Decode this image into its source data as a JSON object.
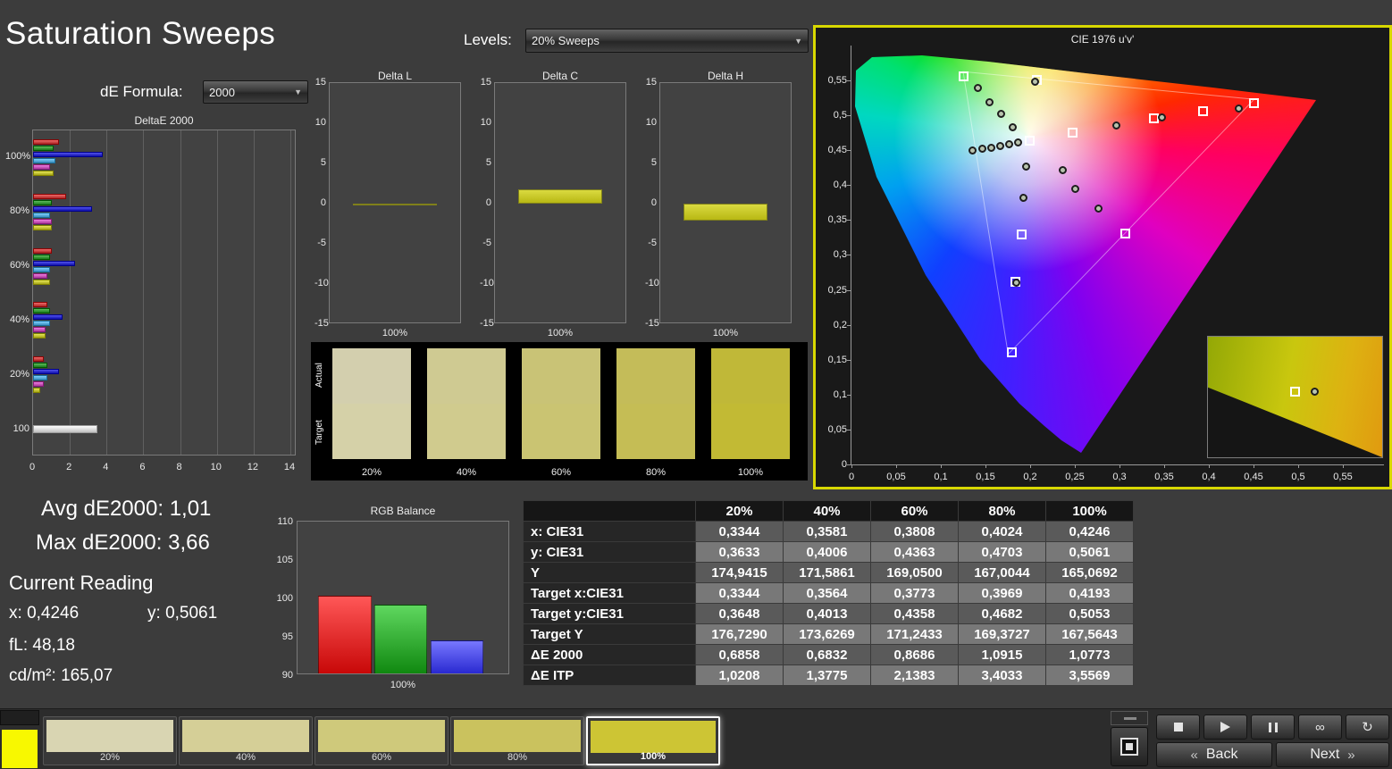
{
  "header": {
    "title": "Saturation Sweeps",
    "levels_label": "Levels:",
    "levels_value": "20% Sweeps",
    "de_formula_label": "dE Formula:",
    "de_formula_value": "2000",
    "dropdown_arrow": "▼"
  },
  "stats": {
    "avg_label": "Avg dE2000:",
    "avg_value": "1,01",
    "max_label": "Max dE2000:",
    "max_value": "3,66"
  },
  "current_reading": {
    "title": "Current Reading",
    "x_label": "x:",
    "x_value": "0,4246",
    "y_label": "y:",
    "y_value": "0,5061",
    "fl_label": "fL:",
    "fl_value": "48,18",
    "cd_label": "cd/m²:",
    "cd_value": "165,07"
  },
  "chart_data": [
    {
      "id": "deltae_2000",
      "type": "bar",
      "orientation": "horizontal",
      "title": "DeltaE 2000",
      "xlim": [
        0,
        14
      ],
      "x_ticks": [
        "0",
        "2",
        "4",
        "6",
        "8",
        "10",
        "12",
        "14"
      ],
      "series_names": [
        "red",
        "green",
        "blue",
        "cyan",
        "magenta",
        "yellow"
      ],
      "series_colors": [
        "#d14a4a",
        "#3f9e3f",
        "#3434cf",
        "#5fb3e0",
        "#cf5fc0",
        "#c9c93a"
      ],
      "grayscale_color": "#e2e2e2",
      "groups": [
        {
          "label": "100%",
          "values": [
            1.4,
            1.1,
            3.8,
            1.2,
            0.9,
            1.1
          ]
        },
        {
          "label": "80%",
          "values": [
            1.8,
            1.0,
            3.2,
            0.9,
            1.0,
            1.0
          ]
        },
        {
          "label": "60%",
          "values": [
            1.0,
            0.9,
            2.3,
            0.9,
            0.8,
            0.9
          ]
        },
        {
          "label": "40%",
          "values": [
            0.8,
            0.9,
            1.6,
            0.9,
            0.7,
            0.7
          ]
        },
        {
          "label": "20%",
          "values": [
            0.6,
            0.8,
            1.4,
            0.8,
            0.6,
            0.4
          ]
        },
        {
          "label": "100",
          "values": [
            3.5
          ],
          "single": true
        }
      ]
    },
    {
      "id": "delta_l",
      "type": "bar",
      "title": "Delta L",
      "ylim": [
        -15,
        15
      ],
      "y_ticks": [
        "15",
        "10",
        "5",
        "0",
        "-5",
        "-10",
        "-15"
      ],
      "xlabel": "100%",
      "categories": [
        "100%"
      ],
      "values": [
        -0.2
      ],
      "bar_color": "#c9c92a"
    },
    {
      "id": "delta_c",
      "type": "bar",
      "title": "Delta C",
      "ylim": [
        -15,
        15
      ],
      "y_ticks": [
        "15",
        "10",
        "5",
        "0",
        "-5",
        "-10",
        "-15"
      ],
      "xlabel": "100%",
      "categories": [
        "100%"
      ],
      "values": [
        1.8
      ],
      "bar_color": "#c9c92a"
    },
    {
      "id": "delta_h",
      "type": "bar",
      "title": "Delta H",
      "ylim": [
        -15,
        15
      ],
      "y_ticks": [
        "15",
        "10",
        "5",
        "0",
        "-5",
        "-10",
        "-15"
      ],
      "xlabel": "100%",
      "categories": [
        "100%"
      ],
      "values": [
        -2.1
      ],
      "bar_color": "#c9c92a"
    },
    {
      "id": "rgb_balance",
      "type": "bar",
      "title": "RGB Balance",
      "ylim": [
        90,
        110
      ],
      "y_ticks": [
        "110",
        "105",
        "100",
        "95",
        "90"
      ],
      "xlabel": "100%",
      "categories": [
        "Red",
        "Green",
        "Blue"
      ],
      "values": [
        100.4,
        99.2,
        94.5
      ],
      "colors": [
        "#e02020",
        "#28a028",
        "#4040e8"
      ]
    },
    {
      "id": "cie_1976",
      "type": "scatter",
      "title": "CIE 1976 u'v'",
      "xlim": [
        0,
        0.6
      ],
      "ylim": [
        0,
        0.6
      ],
      "u_ticks": [
        "0",
        "0,05",
        "0,1",
        "0,15",
        "0,2",
        "0,25",
        "0,3",
        "0,35",
        "0,4",
        "0,45",
        "0,5",
        "0,55"
      ],
      "v_ticks": [
        "0",
        "0,05",
        "0,1",
        "0,15",
        "0,2",
        "0,25",
        "0,3",
        "0,35",
        "0,4",
        "0,45",
        "0,5",
        "0,55"
      ],
      "white_point": {
        "u": 0.198,
        "v": 0.468
      },
      "gamut_triangle": [
        [
          0.125,
          0.5625
        ],
        [
          0.4507,
          0.5229
        ],
        [
          0.1754,
          0.1579
        ]
      ],
      "targets": [
        {
          "u": 0.125,
          "v": 0.556
        },
        {
          "u": 0.207,
          "v": 0.551
        },
        {
          "u": 0.199,
          "v": 0.464
        },
        {
          "u": 0.247,
          "v": 0.475
        },
        {
          "u": 0.338,
          "v": 0.496
        },
        {
          "u": 0.393,
          "v": 0.506
        },
        {
          "u": 0.45,
          "v": 0.518
        },
        {
          "u": 0.19,
          "v": 0.33
        },
        {
          "u": 0.306,
          "v": 0.331
        },
        {
          "u": 0.183,
          "v": 0.262
        },
        {
          "u": 0.179,
          "v": 0.16
        }
      ],
      "measurements": [
        {
          "u": 0.141,
          "v": 0.539
        },
        {
          "u": 0.154,
          "v": 0.519
        },
        {
          "u": 0.167,
          "v": 0.502
        },
        {
          "u": 0.18,
          "v": 0.483
        },
        {
          "u": 0.205,
          "v": 0.548
        },
        {
          "u": 0.135,
          "v": 0.45
        },
        {
          "u": 0.146,
          "v": 0.452
        },
        {
          "u": 0.156,
          "v": 0.454
        },
        {
          "u": 0.166,
          "v": 0.456
        },
        {
          "u": 0.176,
          "v": 0.458
        },
        {
          "u": 0.186,
          "v": 0.461
        },
        {
          "u": 0.296,
          "v": 0.486
        },
        {
          "u": 0.347,
          "v": 0.497
        },
        {
          "u": 0.236,
          "v": 0.421
        },
        {
          "u": 0.25,
          "v": 0.395
        },
        {
          "u": 0.276,
          "v": 0.366
        },
        {
          "u": 0.195,
          "v": 0.427
        },
        {
          "u": 0.192,
          "v": 0.382
        },
        {
          "u": 0.184,
          "v": 0.26
        },
        {
          "u": 0.433,
          "v": 0.51
        }
      ]
    }
  ],
  "swatch_strip": {
    "row_labels": [
      "Actual",
      "Target"
    ],
    "swatches": [
      {
        "label": "20%",
        "actual": "#d3cfae",
        "target": "#d5d1a8"
      },
      {
        "label": "40%",
        "actual": "#cfca92",
        "target": "#d0cb8e"
      },
      {
        "label": "60%",
        "actual": "#c9c376",
        "target": "#cac472"
      },
      {
        "label": "80%",
        "actual": "#c4bc59",
        "target": "#c5bd55"
      },
      {
        "label": "100%",
        "actual": "#c0b838",
        "target": "#c2ba34"
      }
    ]
  },
  "table": {
    "columns": [
      "20%",
      "40%",
      "60%",
      "80%",
      "100%"
    ],
    "rows": [
      {
        "label": "x: CIE31",
        "values": [
          "0,3344",
          "0,3581",
          "0,3808",
          "0,4024",
          "0,4246"
        ]
      },
      {
        "label": "y: CIE31",
        "values": [
          "0,3633",
          "0,4006",
          "0,4363",
          "0,4703",
          "0,5061"
        ]
      },
      {
        "label": "Y",
        "values": [
          "174,9415",
          "171,5861",
          "169,0500",
          "167,0044",
          "165,0692"
        ]
      },
      {
        "label": "Target x:CIE31",
        "values": [
          "0,3344",
          "0,3564",
          "0,3773",
          "0,3969",
          "0,4193"
        ]
      },
      {
        "label": "Target y:CIE31",
        "values": [
          "0,3648",
          "0,4013",
          "0,4358",
          "0,4682",
          "0,5053"
        ]
      },
      {
        "label": "Target Y",
        "values": [
          "176,7290",
          "173,6269",
          "171,2433",
          "169,3727",
          "167,5643"
        ]
      },
      {
        "label": "ΔE 2000",
        "values": [
          "0,6858",
          "0,6832",
          "0,8686",
          "1,0915",
          "1,0773"
        ]
      },
      {
        "label": "ΔE ITP",
        "values": [
          "1,0208",
          "1,3775",
          "2,1383",
          "3,4033",
          "3,5569"
        ]
      }
    ]
  },
  "bottom_bar": {
    "current_color": "#f8f800",
    "patches": [
      {
        "label": "20%",
        "color": "#d9d5b2"
      },
      {
        "label": "40%",
        "color": "#d5cf97"
      },
      {
        "label": "60%",
        "color": "#cfc97b"
      },
      {
        "label": "80%",
        "color": "#cac25e"
      },
      {
        "label": "100%",
        "color": "#cdc534",
        "selected": true
      }
    ],
    "transport": [
      {
        "name": "stop",
        "icon": "stop"
      },
      {
        "name": "play",
        "icon": "play"
      },
      {
        "name": "pause",
        "icon": "pause"
      },
      {
        "name": "continuous",
        "icon": "∞"
      },
      {
        "name": "loop",
        "icon": "↻"
      }
    ],
    "back_chevron": "«",
    "back_label": "Back",
    "next_label": "Next",
    "next_chevron": "»"
  }
}
